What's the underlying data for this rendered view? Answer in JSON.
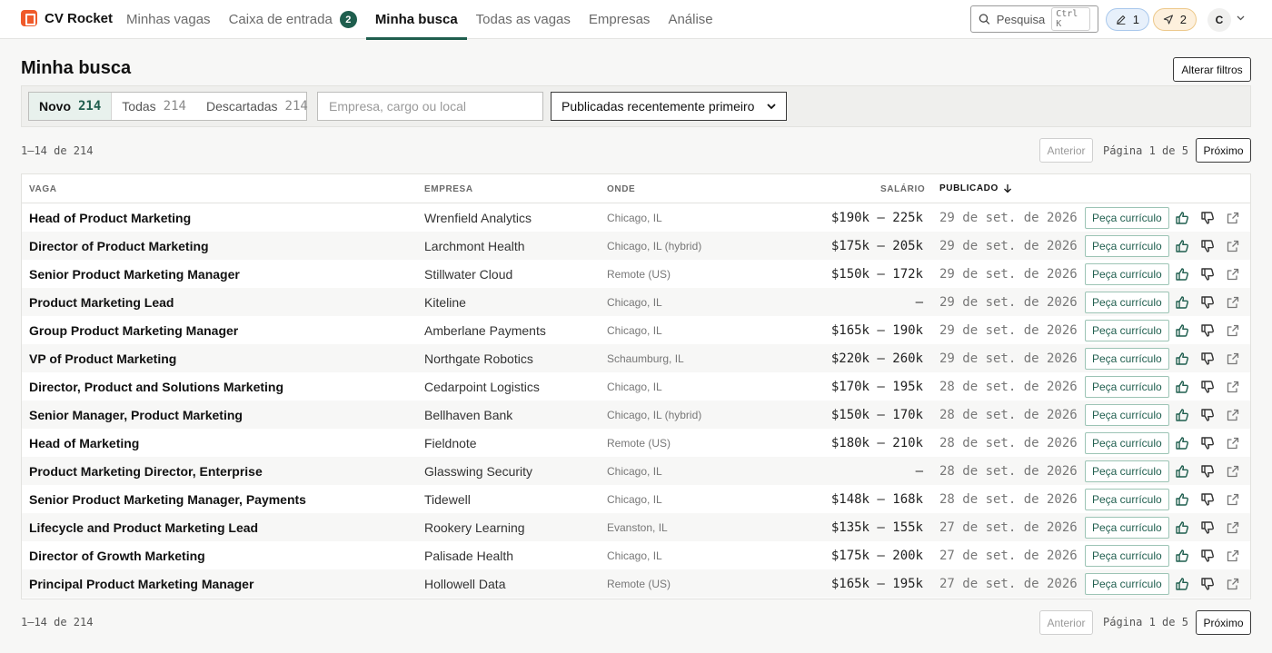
{
  "brand": {
    "name": "CV Rocket"
  },
  "nav": {
    "links": [
      {
        "label": "Minhas vagas"
      },
      {
        "label": "Caixa de entrada",
        "badge": "2"
      },
      {
        "label": "Minha busca"
      },
      {
        "label": "Todas as vagas"
      },
      {
        "label": "Empresas"
      },
      {
        "label": "Análise"
      }
    ],
    "search_label": "Pesquisa",
    "search_shortcut": "Ctrl K",
    "drafts_count": "1",
    "sent_count": "2",
    "avatar_initial": "C"
  },
  "page": {
    "title": "Minha busca",
    "filters_button": "Alterar filtros"
  },
  "tabs": [
    {
      "label": "Novo",
      "count": "214"
    },
    {
      "label": "Todas",
      "count": "214"
    },
    {
      "label": "Descartadas",
      "count": "214"
    }
  ],
  "search": {
    "placeholder": "Empresa, cargo ou local",
    "value": ""
  },
  "sort": {
    "selected": "Publicadas recentemente primeiro"
  },
  "pagination": {
    "range": "1–14 de 214",
    "prev": "Anterior",
    "page_text": "Página 1 de 5",
    "next": "Próximo"
  },
  "table": {
    "headers": {
      "title": "VAGA",
      "company": "EMPRESA",
      "where": "ONDE",
      "salary": "SALÁRIO",
      "posted": "PUBLICADO"
    },
    "cv_label": "Peça currículo",
    "rows": [
      {
        "title": "Head of Product Marketing",
        "company": "Wrenfield Analytics",
        "where": "Chicago, IL",
        "salary": "$190k – 225k",
        "posted": "29 de set. de 2026"
      },
      {
        "title": "Director of Product Marketing",
        "company": "Larchmont Health",
        "where": "Chicago, IL (hybrid)",
        "salary": "$175k – 205k",
        "posted": "29 de set. de 2026"
      },
      {
        "title": "Senior Product Marketing Manager",
        "company": "Stillwater Cloud",
        "where": "Remote (US)",
        "salary": "$150k – 172k",
        "posted": "29 de set. de 2026"
      },
      {
        "title": "Product Marketing Lead",
        "company": "Kiteline",
        "where": "Chicago, IL",
        "salary": "—",
        "posted": "29 de set. de 2026"
      },
      {
        "title": "Group Product Marketing Manager",
        "company": "Amberlane Payments",
        "where": "Chicago, IL",
        "salary": "$165k – 190k",
        "posted": "29 de set. de 2026"
      },
      {
        "title": "VP of Product Marketing",
        "company": "Northgate Robotics",
        "where": "Schaumburg, IL",
        "salary": "$220k – 260k",
        "posted": "29 de set. de 2026"
      },
      {
        "title": "Director, Product and Solutions Marketing",
        "company": "Cedarpoint Logistics",
        "where": "Chicago, IL",
        "salary": "$170k – 195k",
        "posted": "28 de set. de 2026"
      },
      {
        "title": "Senior Manager, Product Marketing",
        "company": "Bellhaven Bank",
        "where": "Chicago, IL (hybrid)",
        "salary": "$150k – 170k",
        "posted": "28 de set. de 2026"
      },
      {
        "title": "Head of Marketing",
        "company": "Fieldnote",
        "where": "Remote (US)",
        "salary": "$180k – 210k",
        "posted": "28 de set. de 2026"
      },
      {
        "title": "Product Marketing Director, Enterprise",
        "company": "Glasswing Security",
        "where": "Chicago, IL",
        "salary": "—",
        "posted": "28 de set. de 2026"
      },
      {
        "title": "Senior Product Marketing Manager, Payments",
        "company": "Tidewell",
        "where": "Chicago, IL",
        "salary": "$148k – 168k",
        "posted": "28 de set. de 2026"
      },
      {
        "title": "Lifecycle and Product Marketing Lead",
        "company": "Rookery Learning",
        "where": "Evanston, IL",
        "salary": "$135k – 155k",
        "posted": "27 de set. de 2026"
      },
      {
        "title": "Director of Growth Marketing",
        "company": "Palisade Health",
        "where": "Chicago, IL",
        "salary": "$175k – 200k",
        "posted": "27 de set. de 2026"
      },
      {
        "title": "Principal Product Marketing Manager",
        "company": "Hollowell Data",
        "where": "Remote (US)",
        "salary": "$165k – 195k",
        "posted": "27 de set. de 2026"
      }
    ]
  }
}
